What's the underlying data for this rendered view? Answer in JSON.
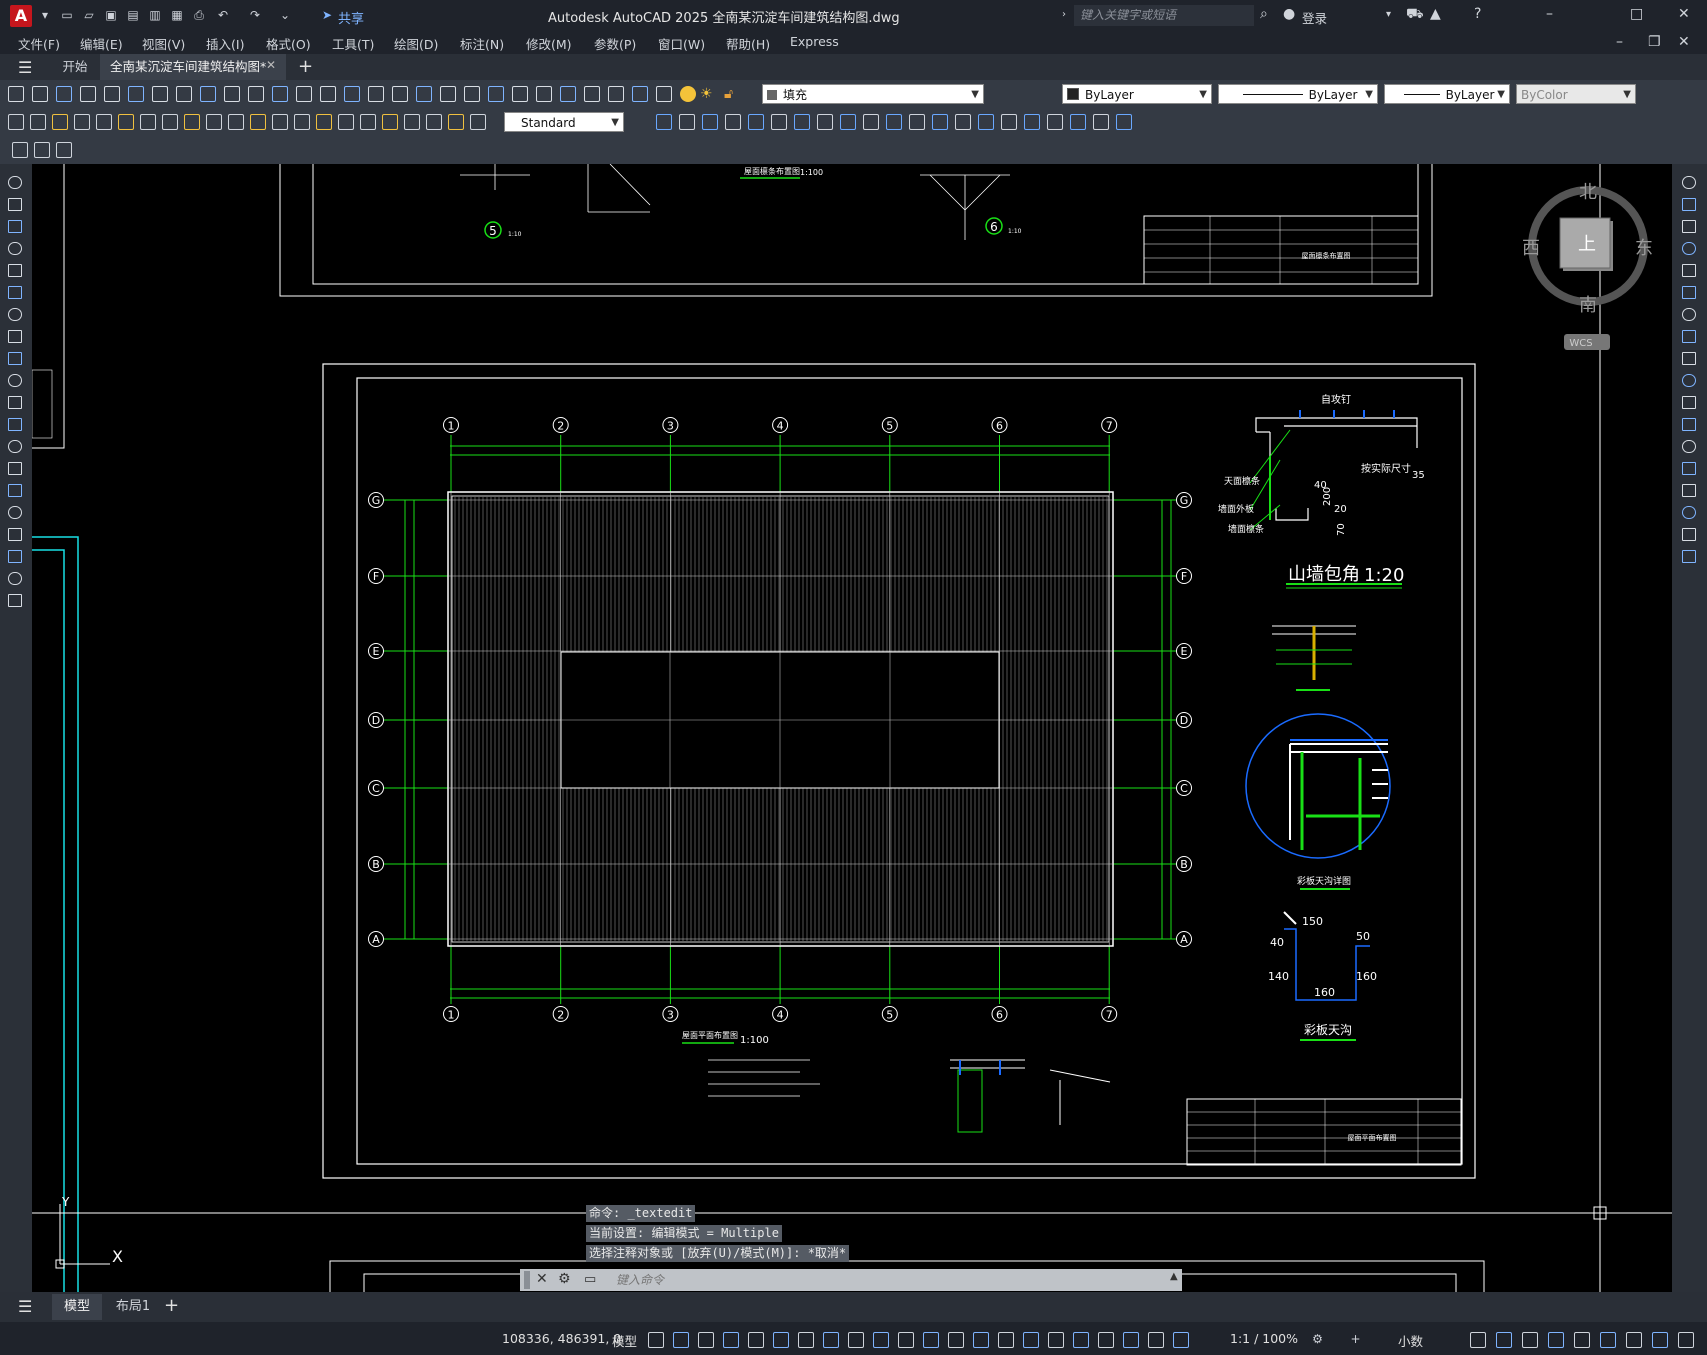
{
  "titlebar": {
    "app_logo": "A",
    "share": "共享",
    "title": "Autodesk AutoCAD 2025    全南某沉淀车间建筑结构图.dwg",
    "search_placeholder": "键入关键字或短语",
    "login": "登录"
  },
  "menu": [
    "文件(F)",
    "编辑(E)",
    "视图(V)",
    "插入(I)",
    "格式(O)",
    "工具(T)",
    "绘图(D)",
    "标注(N)",
    "修改(M)",
    "参数(P)",
    "窗口(W)",
    "帮助(H)",
    "Express"
  ],
  "tabs": {
    "start": "开始",
    "document": "全南某沉淀车间建筑结构图*"
  },
  "toolbar": {
    "layer": "填充",
    "color": "ByLayer",
    "linetype": "ByLayer",
    "lineweight": "ByLayer",
    "plotstyle": "ByColor",
    "dimstyle": "Standard"
  },
  "viewcube": {
    "north": "北",
    "south": "南",
    "west": "西",
    "east": "东",
    "top": "上",
    "wcs": "WCS"
  },
  "drawing": {
    "grid_cols": [
      "1",
      "2",
      "3",
      "4",
      "5",
      "6",
      "7"
    ],
    "grid_rows": [
      "G",
      "F",
      "E",
      "D",
      "C",
      "B",
      "A"
    ],
    "plan_title": "屋面平面布置图",
    "plan_scale": "1:100",
    "top_plan_title": "屋面檩条布置图",
    "top_plan_scale": "1:100",
    "detail_top_label": "自攻钉",
    "detail_label1": "天面檩条",
    "detail_label2": "墙面外板",
    "detail_label3": "墙面檩条",
    "detail_dim_note": "按实际尺寸",
    "detail_title": "山墙包角",
    "detail_scale": "1:20",
    "dim_40": "40",
    "dim_35": "35",
    "dim_200": "200",
    "dim_20": "20",
    "dim_70": "70",
    "gutter_detail_title": "彩板天沟详图",
    "gutter_title": "彩板天沟",
    "gutter_dim_150": "150",
    "gutter_dim_50": "50",
    "gutter_dim_40": "40",
    "gutter_dim_140": "140",
    "gutter_dim_160a": "160",
    "gutter_dim_160b": "160",
    "titleblock_name": "屋面平面布置图",
    "titleblock_name_top": "屋面檩条布置图",
    "detail_num_5": "5",
    "detail_num_6": "6",
    "detail_scale_small": "1:10",
    "axis_y": "Y",
    "axis_x": "X"
  },
  "command": {
    "line1": "命令: _textedit",
    "line2": "当前设置: 编辑模式 = Multiple",
    "line3": "选择注释对象或 [放弃(U)/模式(M)]: *取消*",
    "placeholder": "键入命令"
  },
  "layout_tabs": {
    "model": "模型",
    "layout1": "布局1"
  },
  "status": {
    "coords": "108336, 486391, 0",
    "model": "模型",
    "scale": "1:1 / 100%",
    "units": "小数"
  }
}
